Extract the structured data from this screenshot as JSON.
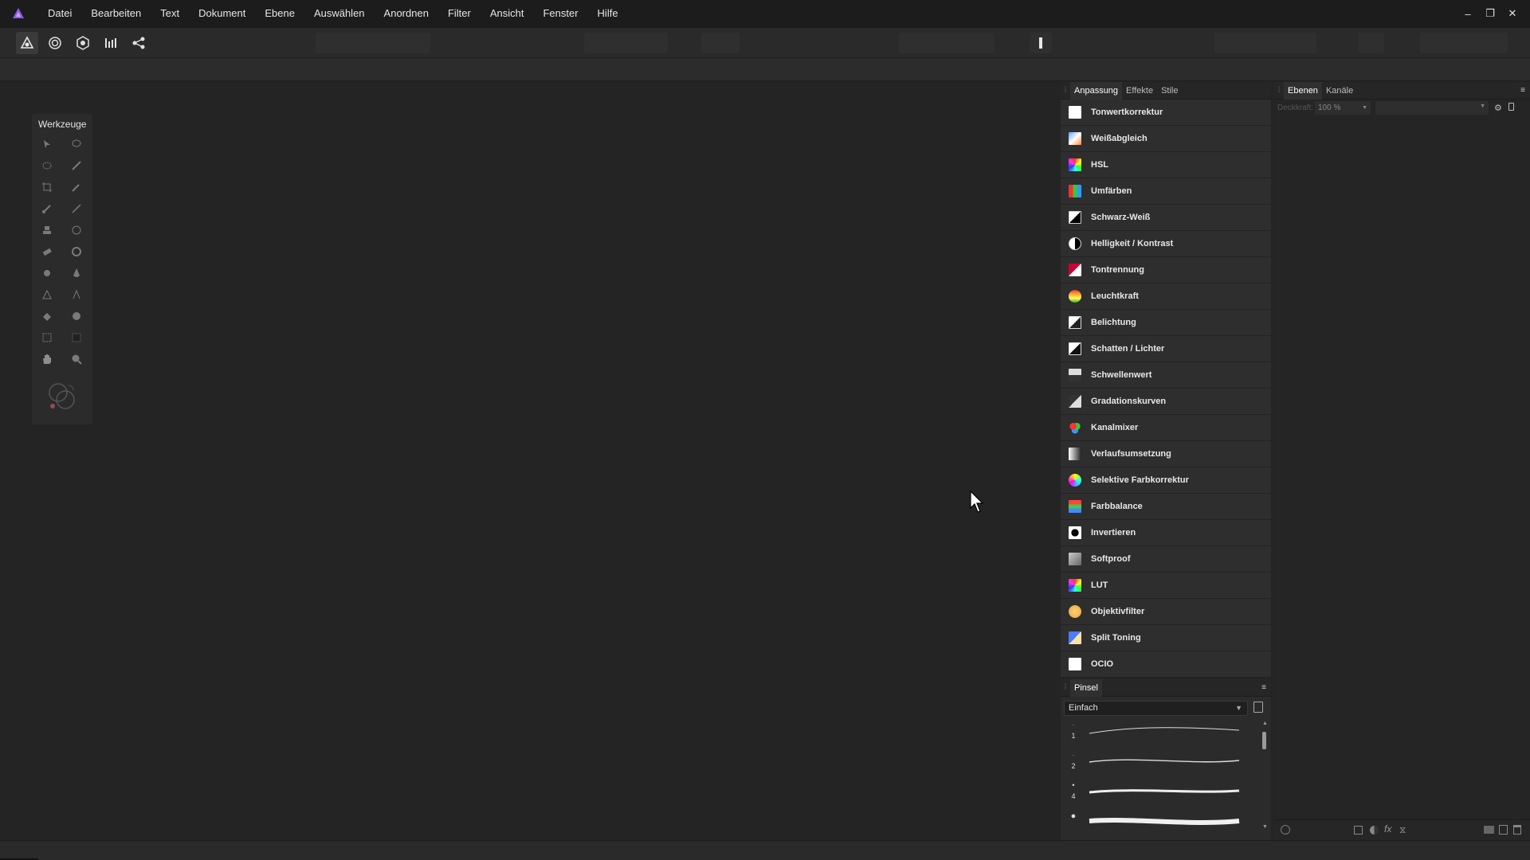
{
  "menubar": {
    "items": [
      "Datei",
      "Bearbeiten",
      "Text",
      "Dokument",
      "Ebene",
      "Auswählen",
      "Anordnen",
      "Filter",
      "Ansicht",
      "Fenster",
      "Hilfe"
    ],
    "window_controls": [
      "–",
      "❐",
      "✕"
    ]
  },
  "toolbar": {
    "persona_buttons": [
      "photo-persona-icon",
      "liquify-persona-icon",
      "develop-persona-icon",
      "tone-mapping-persona-icon",
      "export-persona-icon"
    ]
  },
  "tools_panel": {
    "title": "Werkzeuge"
  },
  "adjustment_panel": {
    "tabs": [
      "Anpassung",
      "Effekte",
      "Stile"
    ],
    "items": [
      {
        "label": "Tonwertkorrektur",
        "icon": "levels-icon"
      },
      {
        "label": "Weißabgleich",
        "icon": "white-balance-icon"
      },
      {
        "label": "HSL",
        "icon": "hsl-icon"
      },
      {
        "label": "Umfärben",
        "icon": "recolor-icon"
      },
      {
        "label": "Schwarz-Weiß",
        "icon": "black-white-icon"
      },
      {
        "label": "Helligkeit / Kontrast",
        "icon": "brightness-contrast-icon"
      },
      {
        "label": "Tontrennung",
        "icon": "posterize-icon"
      },
      {
        "label": "Leuchtkraft",
        "icon": "vibrance-icon"
      },
      {
        "label": "Belichtung",
        "icon": "exposure-icon"
      },
      {
        "label": "Schatten / Lichter",
        "icon": "shadows-highlights-icon"
      },
      {
        "label": "Schwellenwert",
        "icon": "threshold-icon"
      },
      {
        "label": "Gradationskurven",
        "icon": "curves-icon"
      },
      {
        "label": "Kanalmixer",
        "icon": "channel-mixer-icon"
      },
      {
        "label": "Verlaufsumsetzung",
        "icon": "gradient-map-icon"
      },
      {
        "label": "Selektive Farbkorrektur",
        "icon": "selective-colour-icon"
      },
      {
        "label": "Farbbalance",
        "icon": "colour-balance-icon"
      },
      {
        "label": "Invertieren",
        "icon": "invert-icon"
      },
      {
        "label": "Softproof",
        "icon": "soft-proof-icon"
      },
      {
        "label": "LUT",
        "icon": "lut-icon"
      },
      {
        "label": "Objektivfilter",
        "icon": "lens-filter-icon"
      },
      {
        "label": "Split Toning",
        "icon": "split-toning-icon"
      },
      {
        "label": "OCIO",
        "icon": "ocio-icon"
      }
    ]
  },
  "brush_panel": {
    "tab": "Pinsel",
    "category": "Einfach",
    "brush_sizes": [
      "1",
      "2",
      "4",
      ""
    ]
  },
  "layers_panel": {
    "tabs": [
      "Ebenen",
      "Kanäle"
    ],
    "opacity_label": "Deckkraft:",
    "opacity_value": "100 %"
  },
  "colors": {
    "accent": "#7b4fd6",
    "panel": "#2b2b2b",
    "background": "#242424"
  }
}
